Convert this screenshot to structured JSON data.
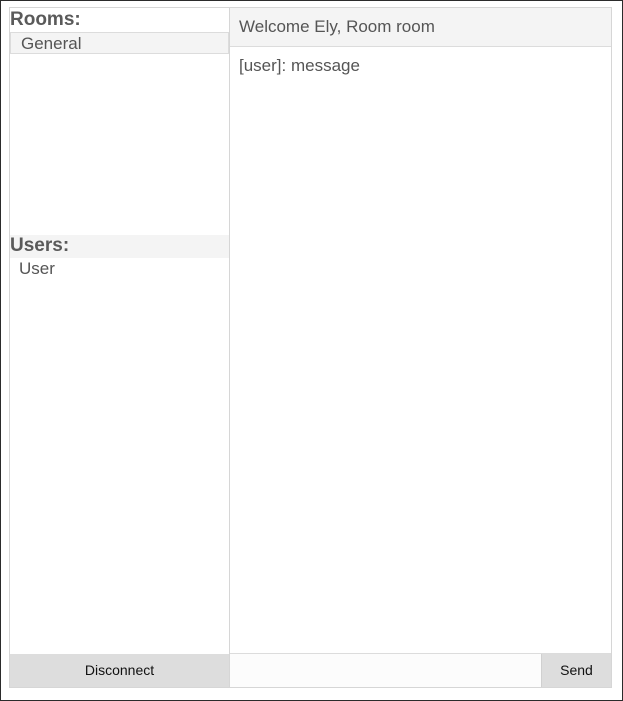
{
  "sidebar": {
    "rooms_heading": "Rooms:",
    "rooms": [
      {
        "label": "General",
        "selected": true
      }
    ],
    "users_heading": "Users:",
    "users": [
      {
        "label": "User"
      }
    ],
    "disconnect_label": "Disconnect"
  },
  "main": {
    "welcome": "Welcome Ely, Room room",
    "messages": [
      {
        "text": "[user]: message"
      }
    ],
    "composer": {
      "value": "",
      "placeholder": "",
      "send_label": "Send"
    }
  },
  "colors": {
    "panel_background": "#f4f4f4",
    "button_background": "#dddddd",
    "border": "#d6d6d6",
    "text": "#555555"
  }
}
